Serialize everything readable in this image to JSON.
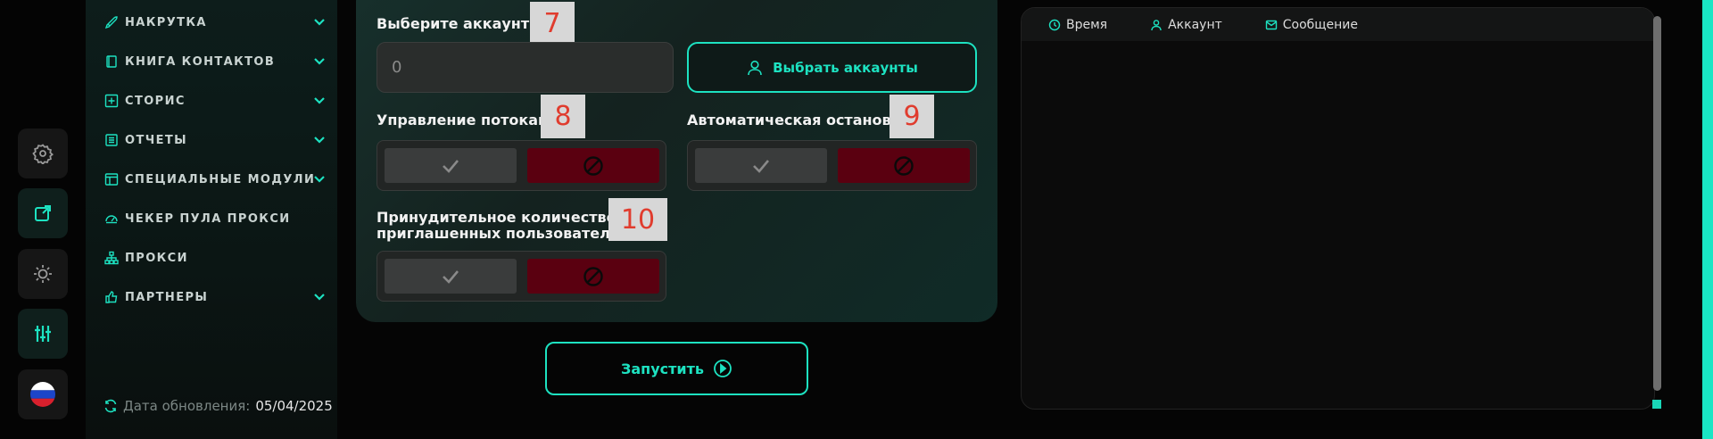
{
  "rail": {
    "items": [
      {
        "name": "settings-icon"
      },
      {
        "name": "external-link-icon"
      },
      {
        "name": "theme-icon"
      },
      {
        "name": "sliders-icon"
      },
      {
        "name": "language-flag-icon"
      }
    ]
  },
  "sidebar": {
    "items": [
      {
        "label": "НАКРУТКА",
        "icon": "rocket-icon",
        "has_chevron": true
      },
      {
        "label": "КНИГА КОНТАКТОВ",
        "icon": "book-icon",
        "has_chevron": true
      },
      {
        "label": "СТОРИС",
        "icon": "plus-square-icon",
        "has_chevron": true
      },
      {
        "label": "ОТЧЕТЫ",
        "icon": "report-icon",
        "has_chevron": true
      },
      {
        "label": "СПЕЦИАЛЬНЫЕ МОДУЛИ",
        "icon": "modules-icon",
        "has_chevron": true
      },
      {
        "label": "ЧЕКЕР ПУЛА ПРОКСИ",
        "icon": "gauge-icon",
        "has_chevron": false
      },
      {
        "label": "ПРОКСИ",
        "icon": "network-icon",
        "has_chevron": false
      },
      {
        "label": "ПАРТНЕРЫ",
        "icon": "thumbs-up-icon",
        "has_chevron": true
      }
    ],
    "update_label": "Дата обновления:",
    "update_value": "05/04/2025"
  },
  "form": {
    "accounts_label": "Выберите аккаунты",
    "accounts_value": "0",
    "select_button": "Выбрать аккаунты",
    "threads_label": "Управление потоками",
    "autostop_label": "Автоматическая остановка",
    "forced_label_line1": "Принудительное количество",
    "forced_label_line2": "приглашенных пользователей",
    "badges": {
      "b7": "7",
      "b8": "8",
      "b9": "9",
      "b10": "10"
    }
  },
  "launch_button": "Запустить",
  "log": {
    "columns": [
      "Время",
      "Аккаунт",
      "Сообщение"
    ]
  },
  "colors": {
    "accent": "#1de2c1",
    "danger": "#5a0010",
    "badge_text": "#e03c2e"
  }
}
